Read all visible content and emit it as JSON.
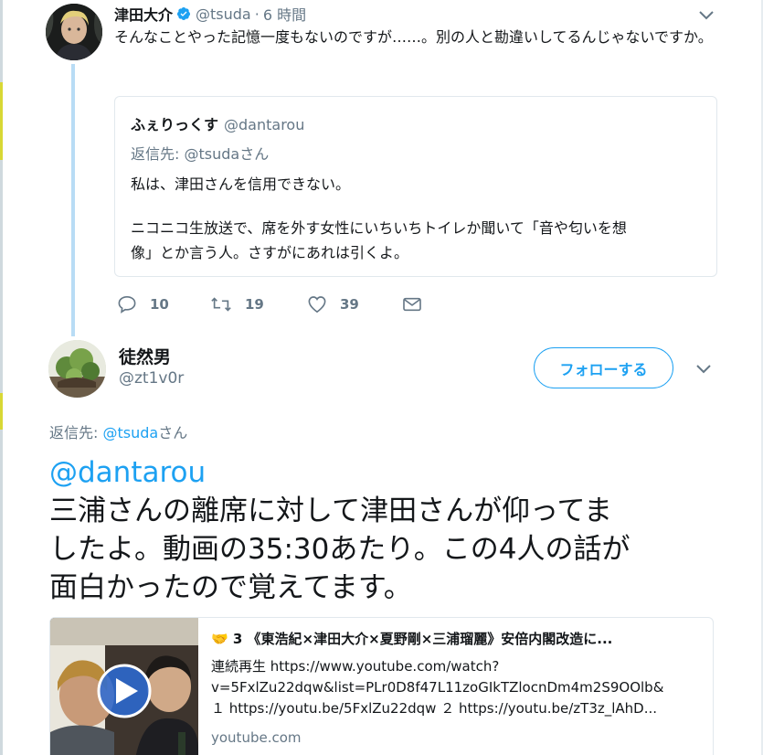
{
  "tweet1": {
    "name": "津田大介",
    "handle": "@tsuda",
    "separator": "·",
    "time": "6 時間",
    "text": "そんなことやった記憶一度もないのですが……。別の人と勘違いしてるんじゃないですか。",
    "quote": {
      "name": "ふぇりっくす",
      "handle": "@dantarou",
      "reply_prefix": "返信先: ",
      "reply_handle": "@tsuda",
      "reply_suffix": "さん",
      "line1": "私は、津田さんを信用できない。",
      "line2": "ニコニコ生放送で、席を外す女性にいちいちトイレか聞いて「音や匂いを想",
      "line3": "像」とか言う人。さすがにあれは引くよ。"
    },
    "actions": {
      "replies": "10",
      "retweets": "19",
      "likes": "39"
    },
    "icons": {
      "verified": "verified-badge-icon",
      "caret": "chevron-down-icon",
      "reply": "reply-icon",
      "retweet": "retweet-icon",
      "like": "heart-icon",
      "dm": "envelope-icon"
    }
  },
  "tweet2": {
    "name": "徒然男",
    "handle": "@zt1v0r",
    "follow_label": "フォローする",
    "reply_prefix": "返信先: ",
    "reply_handle": "@tsuda",
    "reply_suffix": "さん",
    "mention": "@dantarou",
    "line1": "三浦さんの離席に対して津田さんが仰ってま",
    "line2": "したよ。動画の35:30あたり。この4人の話が",
    "line3": "面白かったので覚えてます。",
    "card": {
      "title": "🤝 3 《東浩紀×津田大介×夏野剛×三浦瑠麗》安倍内閣改造に...",
      "desc1": "連続再生 https://www.youtube.com/watch?",
      "desc2": "v=5FxlZu22dqw&list=PLr0D8f47L11zoGIkTZlocnDm4m2S9OOlb&",
      "desc3": "１ https://youtu.be/5FxlZu22dqw ２ https://youtu.be/zT3z_lAhD...",
      "domain": "youtube.com"
    }
  },
  "colors": {
    "accent": "#1da1f2",
    "text": "#14171a",
    "muted": "#657786",
    "thread_line": "#b8dcf5",
    "border": "#e1e8ed"
  }
}
